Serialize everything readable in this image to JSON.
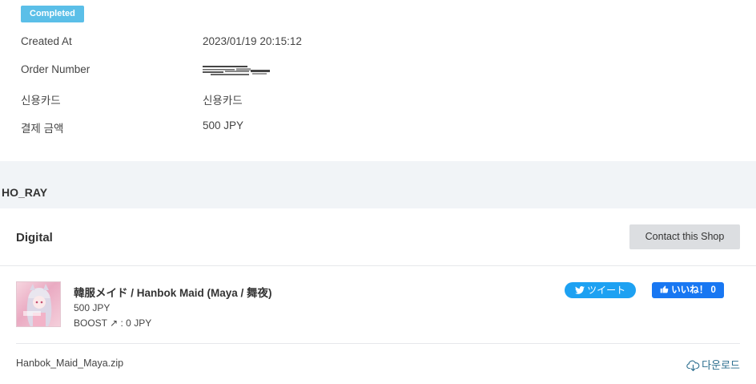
{
  "order": {
    "status": "Completed",
    "rows": [
      {
        "label": "Created At",
        "value": "2023/01/19 20:15:12"
      },
      {
        "label": "Order Number",
        "value": ""
      },
      {
        "label": "신용카드",
        "value": "신용카드"
      },
      {
        "label": "결제 금액",
        "value": "500 JPY"
      }
    ]
  },
  "shop": {
    "name": "HO_RAY"
  },
  "card": {
    "title": "Digital",
    "contact_label": "Contact this Shop",
    "item": {
      "name": "韓服メイド / Hanbok Maid (Maya / 舞夜)",
      "price": "500 JPY",
      "boost": "BOOST ↗ : 0 JPY"
    },
    "tweet_label": "ツイート",
    "like_label": "いいね！ 0",
    "file": {
      "name": "Hanbok_Maid_Maya.zip",
      "download_label": "다운로드"
    }
  },
  "colors": {
    "badge": "#5bbfe8",
    "twitter": "#1da1f2",
    "facebook": "#1877f2",
    "link": "#2a6d8e"
  },
  "icons": [
    "twitter-bird-icon",
    "thumbs-up-icon",
    "cloud-download-icon"
  ]
}
